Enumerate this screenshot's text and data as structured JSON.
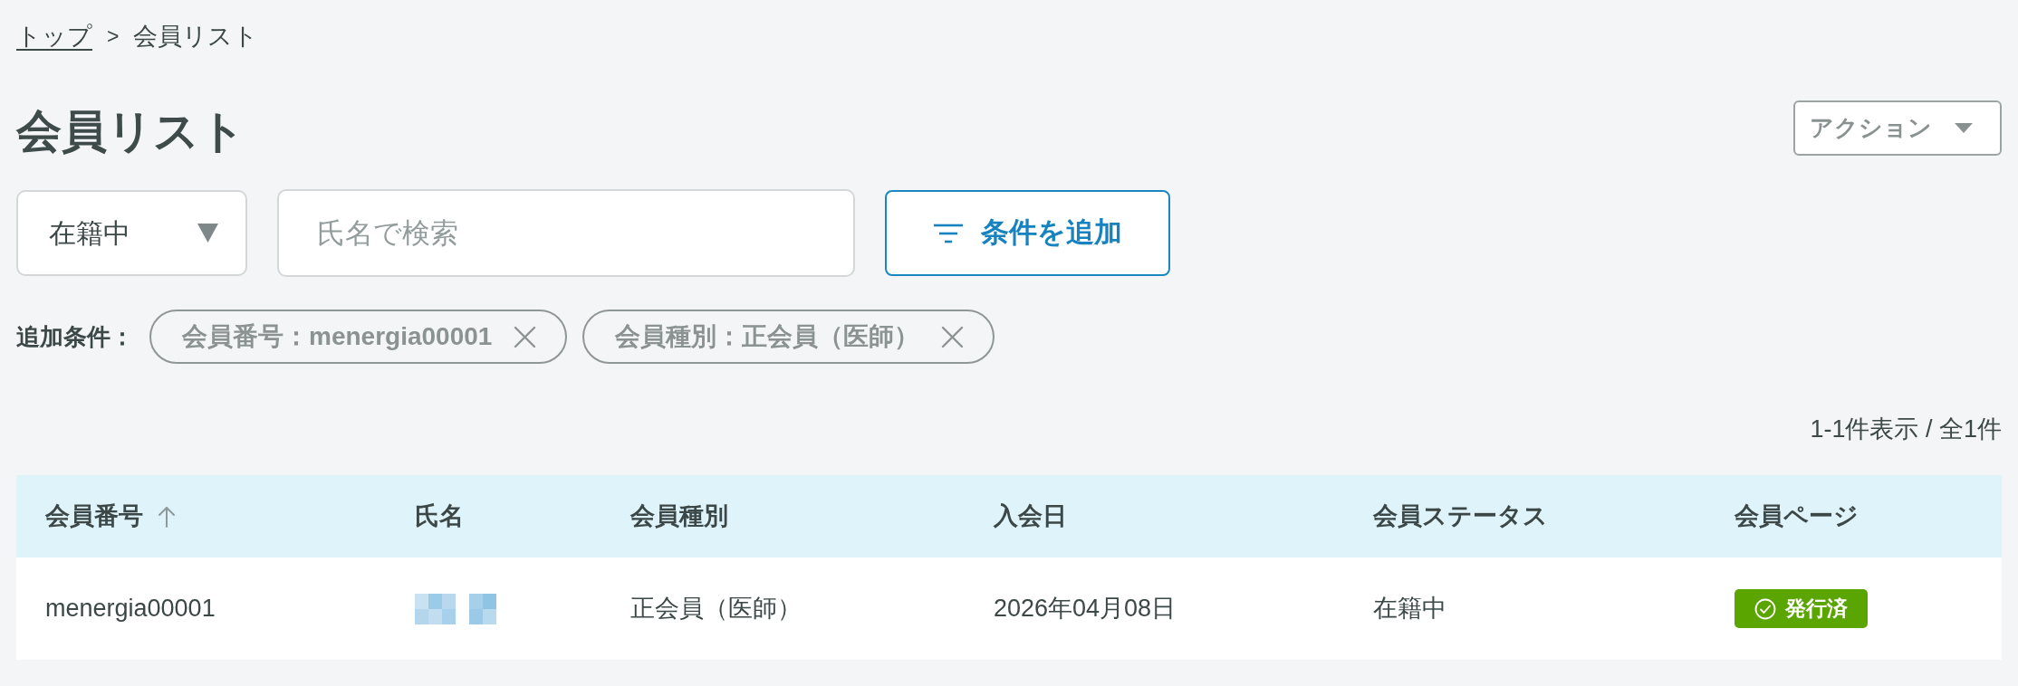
{
  "breadcrumb": {
    "separator": ">",
    "items": [
      {
        "label": "トップ",
        "kind": "link"
      },
      {
        "label": "会員リスト",
        "kind": "current"
      }
    ]
  },
  "page_title": "会員リスト",
  "action_menu": {
    "label": "アクション"
  },
  "filters": {
    "status_select": {
      "value": "在籍中"
    },
    "search": {
      "placeholder": "氏名で検索"
    },
    "add_condition_button": {
      "label": "条件を追加"
    }
  },
  "extra_conditions": {
    "label": "追加条件：",
    "chips": [
      {
        "label": "会員番号：menergia00001"
      },
      {
        "label": "会員種別：正会員（医師）"
      }
    ]
  },
  "result_count": "1-1件表示 / 全1件",
  "table": {
    "columns": [
      {
        "label": "会員番号",
        "sorted": true
      },
      {
        "label": "氏名",
        "sorted": false
      },
      {
        "label": "会員種別",
        "sorted": false
      },
      {
        "label": "入会日",
        "sorted": false
      },
      {
        "label": "会員ステータス",
        "sorted": false
      },
      {
        "label": "会員ページ",
        "sorted": false
      }
    ],
    "rows": [
      {
        "cells": [
          {
            "kind": "text",
            "text": "menergia00001"
          },
          {
            "kind": "redacted"
          },
          {
            "kind": "text",
            "text": "正会員（医師）"
          },
          {
            "kind": "text",
            "text": "2026年04月08日"
          },
          {
            "kind": "text",
            "text": "在籍中"
          },
          {
            "kind": "badge",
            "text": "発行済"
          }
        ]
      }
    ]
  }
}
